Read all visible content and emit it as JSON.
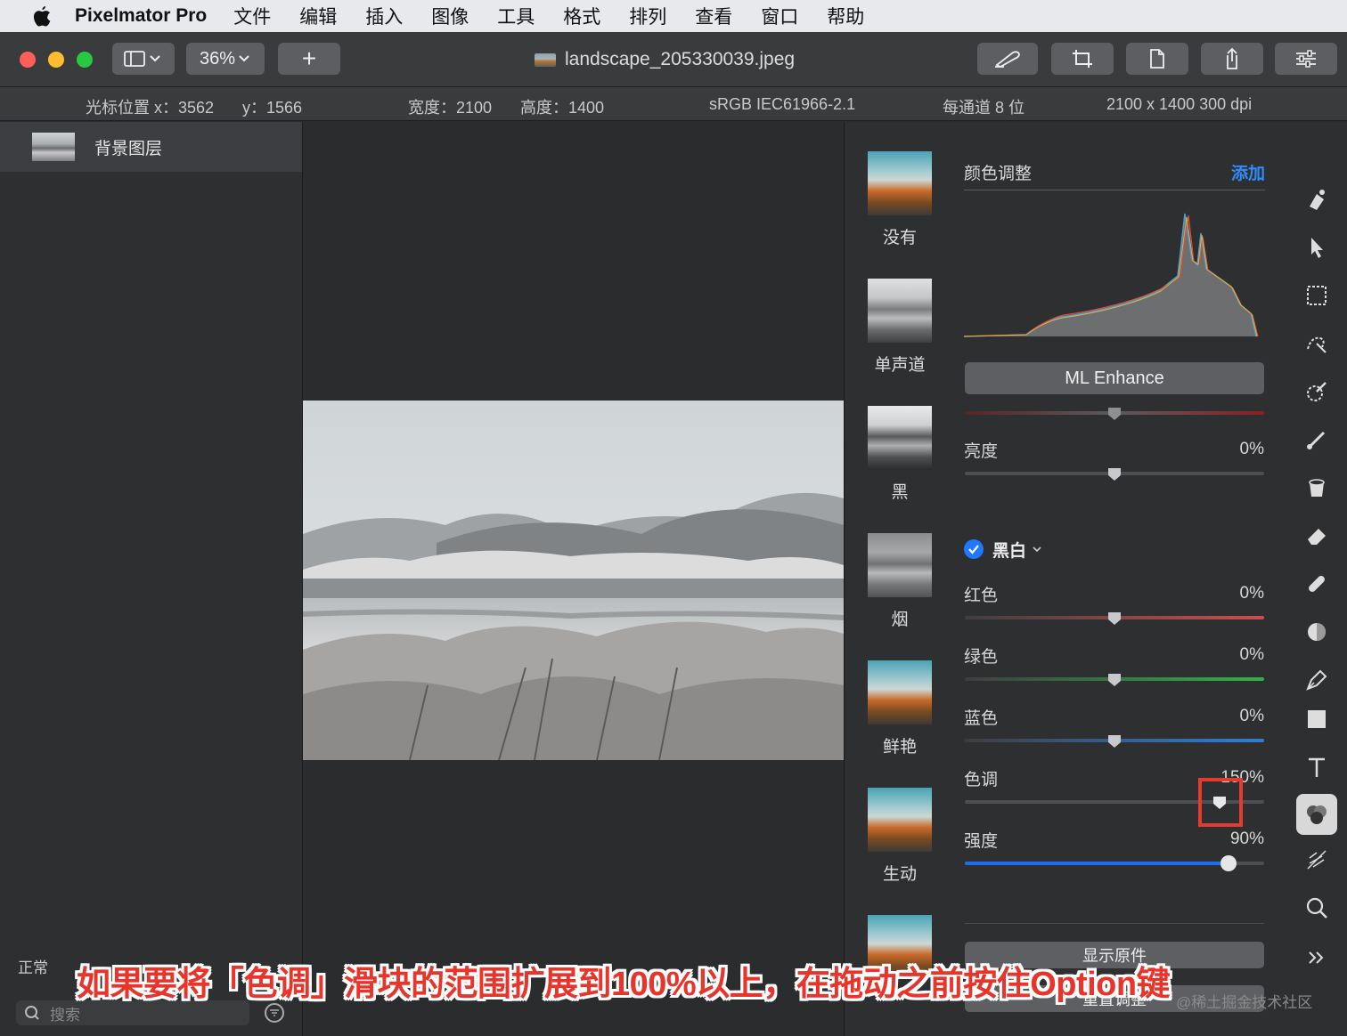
{
  "menubar": {
    "app_name": "Pixelmator Pro",
    "items": [
      "文件",
      "编辑",
      "插入",
      "图像",
      "工具",
      "格式",
      "排列",
      "查看",
      "窗口",
      "帮助"
    ]
  },
  "toolbar": {
    "zoom": "36%",
    "add_symbol": "+",
    "document_title": "landscape_205330039.jpeg"
  },
  "infobar": {
    "cursor_x": "光标位置 x：3562",
    "cursor_y": "y：1566",
    "width": "宽度：2100",
    "height": "高度：1400",
    "color_profile": "sRGB IEC61966-2.1",
    "bit_depth": "每通道 8 位",
    "resolution": "2100 x 1400 300 dpi"
  },
  "layers": {
    "layer_name": "背景图层",
    "blend_mode": "正常",
    "search_placeholder": "搜索"
  },
  "presets": [
    {
      "label": "没有",
      "style": "color"
    },
    {
      "label": "单声道",
      "style": "mono"
    },
    {
      "label": "黑",
      "style": "black"
    },
    {
      "label": "烟",
      "style": "smoke"
    },
    {
      "label": "鲜艳",
      "style": "color"
    },
    {
      "label": "生动",
      "style": "color"
    },
    {
      "label": "",
      "style": "color"
    }
  ],
  "adjustments": {
    "section_title": "颜色调整",
    "add_label": "添加",
    "ml_enhance": "ML Enhance",
    "brightness": {
      "label": "亮度",
      "value": "0%",
      "level": 0.5
    },
    "enhance_slider_level": 0.5,
    "bw": {
      "title": "黑白",
      "red": {
        "label": "红色",
        "value": "0%",
        "level": 0.5
      },
      "green": {
        "label": "绿色",
        "value": "0%",
        "level": 0.5
      },
      "blue": {
        "label": "蓝色",
        "value": "0%",
        "level": 0.5
      },
      "tone": {
        "label": "色调",
        "value": "150%",
        "level": 0.85
      },
      "strength": {
        "label": "强度",
        "value": "90%",
        "level": 0.88
      }
    },
    "show_original": "显示原件",
    "reset": "重置调整"
  },
  "colors": {
    "accent": "#2f8cff",
    "highlight_box": "#e8392f",
    "caption": "#e8352b"
  },
  "caption": "如果要将「色调」滑块的范围扩展到100%以上，在拖动之前按住Option键",
  "watermark": "@稀土掘金技术社区"
}
